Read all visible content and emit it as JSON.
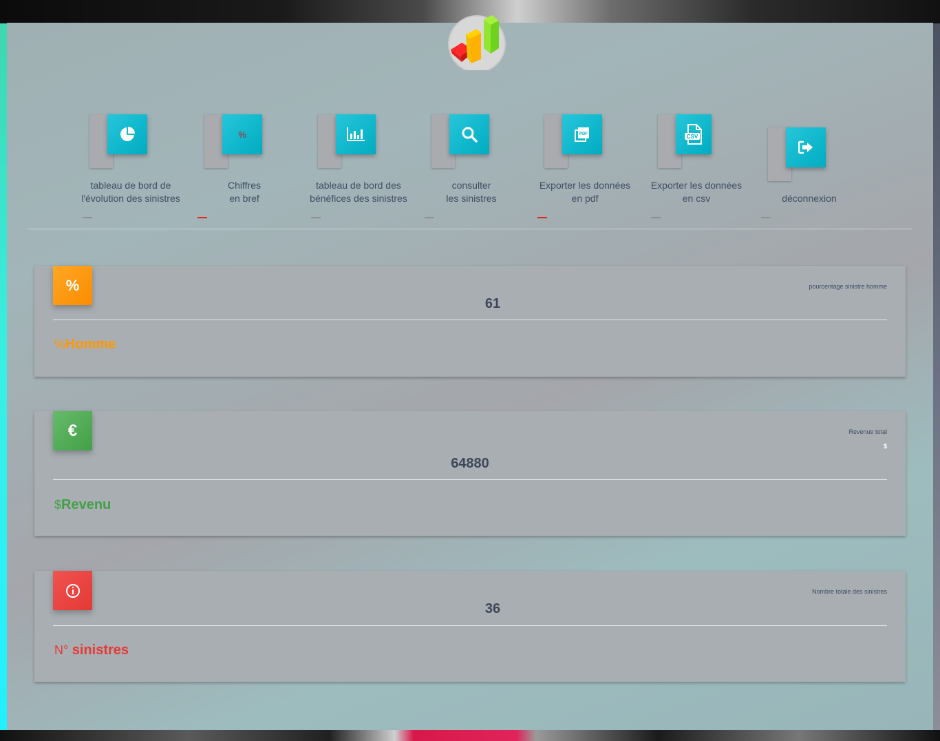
{
  "nav": {
    "items": [
      {
        "label_line1": "tableau de bord de",
        "label_line2": "l'évolution des sinistres",
        "icon": "pie-chart-icon"
      },
      {
        "label_line1": "Chiffres",
        "label_line2": "en bref",
        "icon": "percent-icon",
        "icon_text": "%"
      },
      {
        "label_line1": "tableau de bord des",
        "label_line2": "bénéfices des sinistres",
        "icon": "bar-chart-icon"
      },
      {
        "label_line1": "consulter",
        "label_line2": "les sinistres",
        "icon": "search-icon"
      },
      {
        "label_line1": "Exporter les données",
        "label_line2": "en pdf",
        "icon": "pdf-icon",
        "icon_text": "PDF"
      },
      {
        "label_line1": "Exporter les données",
        "label_line2": "en csv",
        "icon": "csv-icon",
        "icon_text": "CSV"
      },
      {
        "label_line1": "déconnexion",
        "icon": "logout-icon"
      }
    ],
    "dash_colors": [
      "#8d8f93",
      "#e0241b",
      "#8d8f93",
      "#8d8f93",
      "#e0241b",
      "#8d8f93",
      "#8d8f93"
    ]
  },
  "cards": [
    {
      "icon": "percent-icon",
      "icon_text": "%",
      "icon_color": "#ff9800",
      "category": "pourcentage sinistre homme",
      "value": "61",
      "footer_prefix": "%",
      "footer_label": "Homme",
      "footer_color": "#ff9800"
    },
    {
      "icon": "euro-icon",
      "icon_text": "€",
      "icon_color": "#4caf50",
      "category": "Revenue total",
      "category_sub": "$",
      "value": "64880",
      "footer_prefix": "$",
      "footer_label": "Revenu",
      "footer_color": "#43a047"
    },
    {
      "icon": "info-icon",
      "icon_color": "#e53935",
      "category": "Nombre totale des sinistres",
      "value": "36",
      "footer_prefix": "N°",
      "footer_label": "sinistres",
      "footer_color": "#e53935"
    }
  ]
}
